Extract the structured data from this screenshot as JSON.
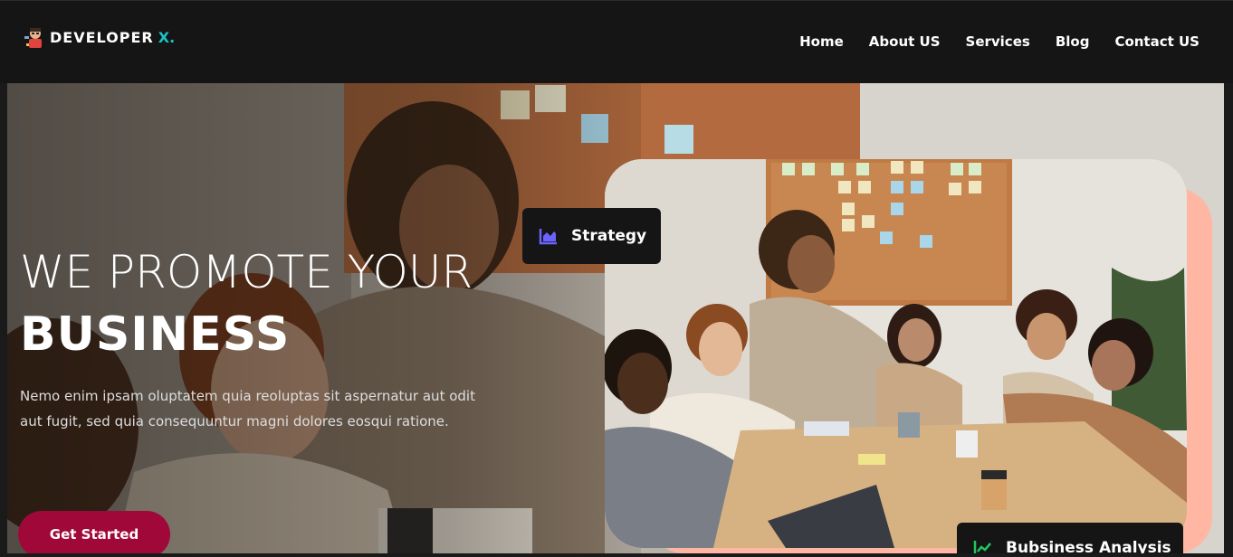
{
  "brand": {
    "name": "DEVELOPER",
    "accent": "X.",
    "accent_color": "#19c2c8",
    "logo_icon": "developer-avatar-icon"
  },
  "nav": {
    "items": [
      "Home",
      "About US",
      "Services",
      "Blog",
      "Contact US"
    ]
  },
  "hero": {
    "headline_line1": "WE PROMOTE YOUR",
    "headline_line2": "BUSINESS",
    "description": "Nemo enim ipsam oluptatem quia reoluptas sit aspernatur aut odit aut fugit, sed quia consequuntur magni dolores eosqui ratione.",
    "cta_label": "Get Started",
    "cta_color": "#a0083a"
  },
  "badges": {
    "strategy": {
      "label": "Strategy",
      "icon": "area-chart-icon",
      "icon_color": "#6c63ff"
    },
    "analysis": {
      "label": "Bubsiness Analysis",
      "icon": "line-chart-icon",
      "icon_color": "#22c55e"
    }
  },
  "colors": {
    "navbar_bg": "#151515",
    "photo_shadow": "#ffb7a4"
  }
}
